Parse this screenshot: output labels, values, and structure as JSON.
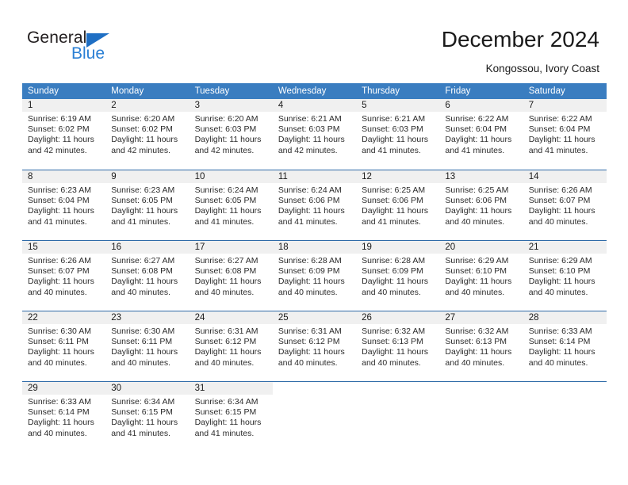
{
  "brand": {
    "name_part1": "General",
    "name_part2": "Blue",
    "triangle_color": "#1f6fc4",
    "blue_color": "#2a7fd4"
  },
  "header": {
    "title": "December 2024",
    "subtitle": "Kongossou, Ivory Coast"
  },
  "theme": {
    "header_bg": "#3a7dc0",
    "row_divider": "#2f6ba8",
    "daynum_bg": "#f0f0f0",
    "text": "#2b2b2b"
  },
  "calendar": {
    "weekdays": [
      "Sunday",
      "Monday",
      "Tuesday",
      "Wednesday",
      "Thursday",
      "Friday",
      "Saturday"
    ],
    "weeks": [
      [
        {
          "day": "1",
          "sunrise": "Sunrise: 6:19 AM",
          "sunset": "Sunset: 6:02 PM",
          "daylight1": "Daylight: 11 hours",
          "daylight2": "and 42 minutes."
        },
        {
          "day": "2",
          "sunrise": "Sunrise: 6:20 AM",
          "sunset": "Sunset: 6:02 PM",
          "daylight1": "Daylight: 11 hours",
          "daylight2": "and 42 minutes."
        },
        {
          "day": "3",
          "sunrise": "Sunrise: 6:20 AM",
          "sunset": "Sunset: 6:03 PM",
          "daylight1": "Daylight: 11 hours",
          "daylight2": "and 42 minutes."
        },
        {
          "day": "4",
          "sunrise": "Sunrise: 6:21 AM",
          "sunset": "Sunset: 6:03 PM",
          "daylight1": "Daylight: 11 hours",
          "daylight2": "and 42 minutes."
        },
        {
          "day": "5",
          "sunrise": "Sunrise: 6:21 AM",
          "sunset": "Sunset: 6:03 PM",
          "daylight1": "Daylight: 11 hours",
          "daylight2": "and 41 minutes."
        },
        {
          "day": "6",
          "sunrise": "Sunrise: 6:22 AM",
          "sunset": "Sunset: 6:04 PM",
          "daylight1": "Daylight: 11 hours",
          "daylight2": "and 41 minutes."
        },
        {
          "day": "7",
          "sunrise": "Sunrise: 6:22 AM",
          "sunset": "Sunset: 6:04 PM",
          "daylight1": "Daylight: 11 hours",
          "daylight2": "and 41 minutes."
        }
      ],
      [
        {
          "day": "8",
          "sunrise": "Sunrise: 6:23 AM",
          "sunset": "Sunset: 6:04 PM",
          "daylight1": "Daylight: 11 hours",
          "daylight2": "and 41 minutes."
        },
        {
          "day": "9",
          "sunrise": "Sunrise: 6:23 AM",
          "sunset": "Sunset: 6:05 PM",
          "daylight1": "Daylight: 11 hours",
          "daylight2": "and 41 minutes."
        },
        {
          "day": "10",
          "sunrise": "Sunrise: 6:24 AM",
          "sunset": "Sunset: 6:05 PM",
          "daylight1": "Daylight: 11 hours",
          "daylight2": "and 41 minutes."
        },
        {
          "day": "11",
          "sunrise": "Sunrise: 6:24 AM",
          "sunset": "Sunset: 6:06 PM",
          "daylight1": "Daylight: 11 hours",
          "daylight2": "and 41 minutes."
        },
        {
          "day": "12",
          "sunrise": "Sunrise: 6:25 AM",
          "sunset": "Sunset: 6:06 PM",
          "daylight1": "Daylight: 11 hours",
          "daylight2": "and 41 minutes."
        },
        {
          "day": "13",
          "sunrise": "Sunrise: 6:25 AM",
          "sunset": "Sunset: 6:06 PM",
          "daylight1": "Daylight: 11 hours",
          "daylight2": "and 40 minutes."
        },
        {
          "day": "14",
          "sunrise": "Sunrise: 6:26 AM",
          "sunset": "Sunset: 6:07 PM",
          "daylight1": "Daylight: 11 hours",
          "daylight2": "and 40 minutes."
        }
      ],
      [
        {
          "day": "15",
          "sunrise": "Sunrise: 6:26 AM",
          "sunset": "Sunset: 6:07 PM",
          "daylight1": "Daylight: 11 hours",
          "daylight2": "and 40 minutes."
        },
        {
          "day": "16",
          "sunrise": "Sunrise: 6:27 AM",
          "sunset": "Sunset: 6:08 PM",
          "daylight1": "Daylight: 11 hours",
          "daylight2": "and 40 minutes."
        },
        {
          "day": "17",
          "sunrise": "Sunrise: 6:27 AM",
          "sunset": "Sunset: 6:08 PM",
          "daylight1": "Daylight: 11 hours",
          "daylight2": "and 40 minutes."
        },
        {
          "day": "18",
          "sunrise": "Sunrise: 6:28 AM",
          "sunset": "Sunset: 6:09 PM",
          "daylight1": "Daylight: 11 hours",
          "daylight2": "and 40 minutes."
        },
        {
          "day": "19",
          "sunrise": "Sunrise: 6:28 AM",
          "sunset": "Sunset: 6:09 PM",
          "daylight1": "Daylight: 11 hours",
          "daylight2": "and 40 minutes."
        },
        {
          "day": "20",
          "sunrise": "Sunrise: 6:29 AM",
          "sunset": "Sunset: 6:10 PM",
          "daylight1": "Daylight: 11 hours",
          "daylight2": "and 40 minutes."
        },
        {
          "day": "21",
          "sunrise": "Sunrise: 6:29 AM",
          "sunset": "Sunset: 6:10 PM",
          "daylight1": "Daylight: 11 hours",
          "daylight2": "and 40 minutes."
        }
      ],
      [
        {
          "day": "22",
          "sunrise": "Sunrise: 6:30 AM",
          "sunset": "Sunset: 6:11 PM",
          "daylight1": "Daylight: 11 hours",
          "daylight2": "and 40 minutes."
        },
        {
          "day": "23",
          "sunrise": "Sunrise: 6:30 AM",
          "sunset": "Sunset: 6:11 PM",
          "daylight1": "Daylight: 11 hours",
          "daylight2": "and 40 minutes."
        },
        {
          "day": "24",
          "sunrise": "Sunrise: 6:31 AM",
          "sunset": "Sunset: 6:12 PM",
          "daylight1": "Daylight: 11 hours",
          "daylight2": "and 40 minutes."
        },
        {
          "day": "25",
          "sunrise": "Sunrise: 6:31 AM",
          "sunset": "Sunset: 6:12 PM",
          "daylight1": "Daylight: 11 hours",
          "daylight2": "and 40 minutes."
        },
        {
          "day": "26",
          "sunrise": "Sunrise: 6:32 AM",
          "sunset": "Sunset: 6:13 PM",
          "daylight1": "Daylight: 11 hours",
          "daylight2": "and 40 minutes."
        },
        {
          "day": "27",
          "sunrise": "Sunrise: 6:32 AM",
          "sunset": "Sunset: 6:13 PM",
          "daylight1": "Daylight: 11 hours",
          "daylight2": "and 40 minutes."
        },
        {
          "day": "28",
          "sunrise": "Sunrise: 6:33 AM",
          "sunset": "Sunset: 6:14 PM",
          "daylight1": "Daylight: 11 hours",
          "daylight2": "and 40 minutes."
        }
      ],
      [
        {
          "day": "29",
          "sunrise": "Sunrise: 6:33 AM",
          "sunset": "Sunset: 6:14 PM",
          "daylight1": "Daylight: 11 hours",
          "daylight2": "and 40 minutes."
        },
        {
          "day": "30",
          "sunrise": "Sunrise: 6:34 AM",
          "sunset": "Sunset: 6:15 PM",
          "daylight1": "Daylight: 11 hours",
          "daylight2": "and 41 minutes."
        },
        {
          "day": "31",
          "sunrise": "Sunrise: 6:34 AM",
          "sunset": "Sunset: 6:15 PM",
          "daylight1": "Daylight: 11 hours",
          "daylight2": "and 41 minutes."
        },
        {
          "day": "",
          "sunrise": "",
          "sunset": "",
          "daylight1": "",
          "daylight2": ""
        },
        {
          "day": "",
          "sunrise": "",
          "sunset": "",
          "daylight1": "",
          "daylight2": ""
        },
        {
          "day": "",
          "sunrise": "",
          "sunset": "",
          "daylight1": "",
          "daylight2": ""
        },
        {
          "day": "",
          "sunrise": "",
          "sunset": "",
          "daylight1": "",
          "daylight2": ""
        }
      ]
    ]
  }
}
